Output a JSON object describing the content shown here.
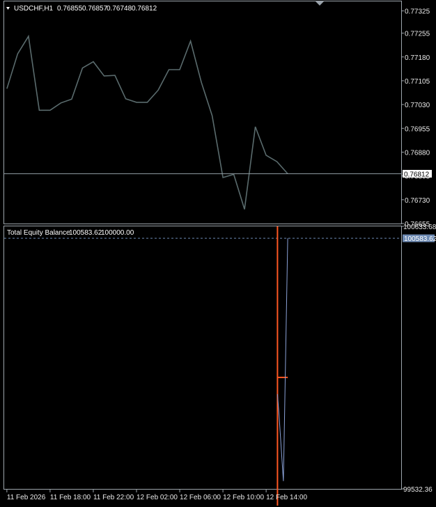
{
  "chart_data": [
    {
      "type": "line",
      "title": "USDCHF,H1",
      "ohlc": [
        "0.76855",
        "0.76857",
        "0.76748",
        "0.76812"
      ],
      "x": [
        1,
        2,
        3,
        4,
        5,
        6,
        7,
        8,
        9,
        10,
        11,
        12,
        13,
        14,
        15,
        16,
        17,
        18,
        19,
        20,
        21,
        22,
        23,
        24,
        25,
        26,
        27
      ],
      "series": [
        {
          "values": [
            0.7708,
            0.7719,
            0.77245,
            0.77012,
            0.77012,
            0.77035,
            0.77047,
            0.77145,
            0.77165,
            0.7712,
            0.77122,
            0.77048,
            0.77037,
            0.77037,
            0.77075,
            0.7714,
            0.7714,
            0.7723,
            0.771,
            0.76995,
            0.768,
            0.7681,
            0.767,
            0.7696,
            0.7687,
            0.7685,
            0.76812
          ]
        }
      ],
      "current_price": 0.76812,
      "current_price_label": "0.76812",
      "ylim": [
        0.76655,
        0.77355
      ],
      "ytick_values": [
        0.77325,
        0.77255,
        0.7718,
        0.77105,
        0.7703,
        0.76955,
        0.7688,
        0.76805,
        0.7673,
        0.76655
      ],
      "yticks": [
        "0.77325",
        "0.77255",
        "0.77180",
        "0.77105",
        "0.77030",
        "0.76955",
        "0.76880",
        "0.76805",
        "0.76730",
        "0.76655"
      ],
      "colors": {
        "line": "#5a6b6d",
        "price_line": "#8d99a0",
        "background": "#000000",
        "axis_text": "#e9e9e9"
      }
    },
    {
      "type": "line",
      "title": "Total Equity Balance",
      "legend_values": [
        "100583.62",
        "100000.00"
      ],
      "x": [
        26.05,
        26.2,
        26.6,
        27
      ],
      "series": [
        {
          "values": [
            99930,
            99840,
            99565,
            100583.62
          ],
          "color": "#8ba2d8"
        }
      ],
      "balance_value": 100000.0,
      "balance_x_range": [
        26.05,
        27
      ],
      "current_equity_label": "100583.62",
      "ylim": [
        99532.36,
        100633.68
      ],
      "ytick_values": [
        100633.68,
        99532.36
      ],
      "yticks": [
        "100633.68",
        "99532.36"
      ],
      "test_start_x": 26.05,
      "xlim": [
        0.75,
        37.5
      ],
      "xtick_positions": [
        1,
        5,
        9,
        13,
        17,
        21,
        25
      ],
      "xticks": [
        "11 Feb 2026",
        "11 Feb 18:00",
        "11 Feb 22:00",
        "12 Feb 02:00",
        "12 Feb 06:00",
        "12 Feb 10:00",
        "12 Feb 14:00"
      ],
      "colors": {
        "equity": "#8ba2d8",
        "balance": "#ff5722",
        "test_start": "#ff5722",
        "equity_dashed": "#6d8ab3",
        "equity_label_bg": "#6d8ab3"
      }
    }
  ]
}
